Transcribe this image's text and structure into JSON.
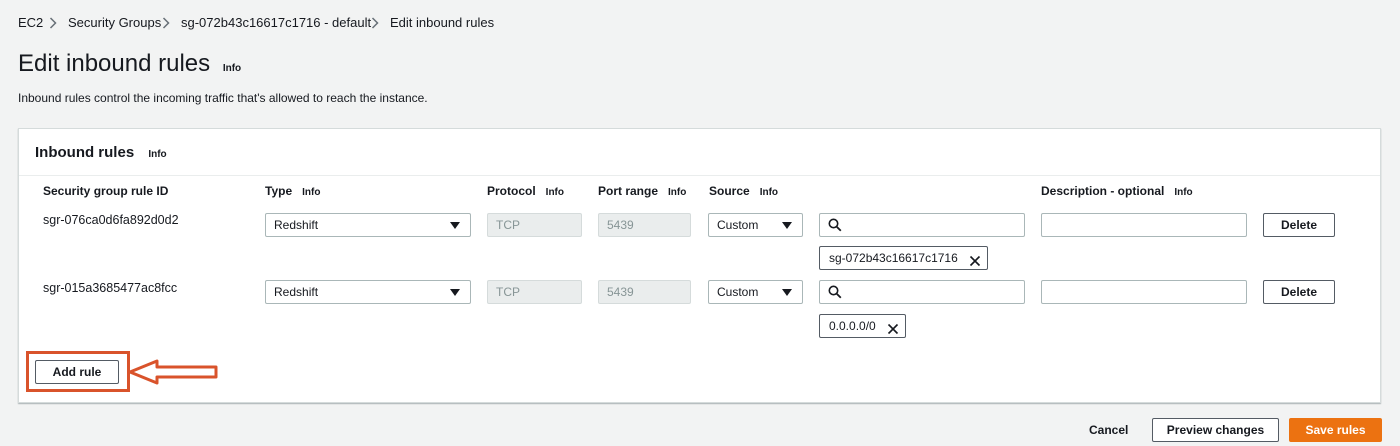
{
  "breadcrumb": {
    "items": [
      "EC2",
      "Security Groups",
      "sg-072b43c16617c1716 - default",
      "Edit inbound rules"
    ]
  },
  "header": {
    "title": "Edit inbound rules",
    "info": "Info",
    "description": "Inbound rules control the incoming traffic that's allowed to reach the instance."
  },
  "panel": {
    "title": "Inbound rules",
    "info": "Info",
    "columns": {
      "rule_id": "Security group rule ID",
      "type": "Type",
      "protocol": "Protocol",
      "port_range": "Port range",
      "source": "Source",
      "description": "Description - optional",
      "info": "Info"
    },
    "rules": [
      {
        "id": "sgr-076ca0d6fa892d0d2",
        "type": "Redshift",
        "protocol": "TCP",
        "port_range": "5439",
        "source": "Custom",
        "search_value": "",
        "token": "sg-072b43c16617c1716",
        "description": "",
        "delete_label": "Delete"
      },
      {
        "id": "sgr-015a3685477ac8fcc",
        "type": "Redshift",
        "protocol": "TCP",
        "port_range": "5439",
        "source": "Custom",
        "search_value": "",
        "token": "0.0.0.0/0",
        "description": "",
        "delete_label": "Delete"
      }
    ],
    "add_rule_label": "Add rule"
  },
  "footer": {
    "cancel_label": "Cancel",
    "preview_label": "Preview changes",
    "save_label": "Save rules"
  },
  "colors": {
    "primary": "#ec7211",
    "highlight": "#d9532b",
    "text": "#16191f"
  }
}
